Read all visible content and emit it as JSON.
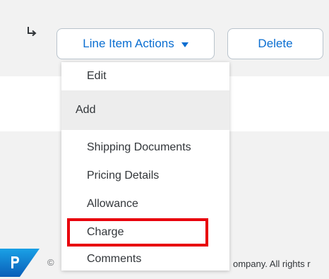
{
  "toolbar": {
    "return_icon": "return-arrow-icon",
    "line_item_actions_label": "Line Item Actions",
    "dropdown_icon": "caret-down-icon",
    "delete_label": "Delete"
  },
  "menu": {
    "items": [
      {
        "label": "Edit"
      },
      {
        "label": "Add",
        "group": true
      },
      {
        "label": "Shipping Documents"
      },
      {
        "label": "Pricing Details"
      },
      {
        "label": "Allowance"
      },
      {
        "label": "Charge",
        "highlighted": true
      },
      {
        "label": "Comments"
      }
    ]
  },
  "footer": {
    "logo": "sap-logo",
    "copyright_symbol": "©",
    "copyright_text": "ompany. All rights r"
  },
  "colors": {
    "accent": "#0a6ed1",
    "highlight": "#e8000b",
    "text": "#32363a",
    "band": "#f2f2f2"
  }
}
